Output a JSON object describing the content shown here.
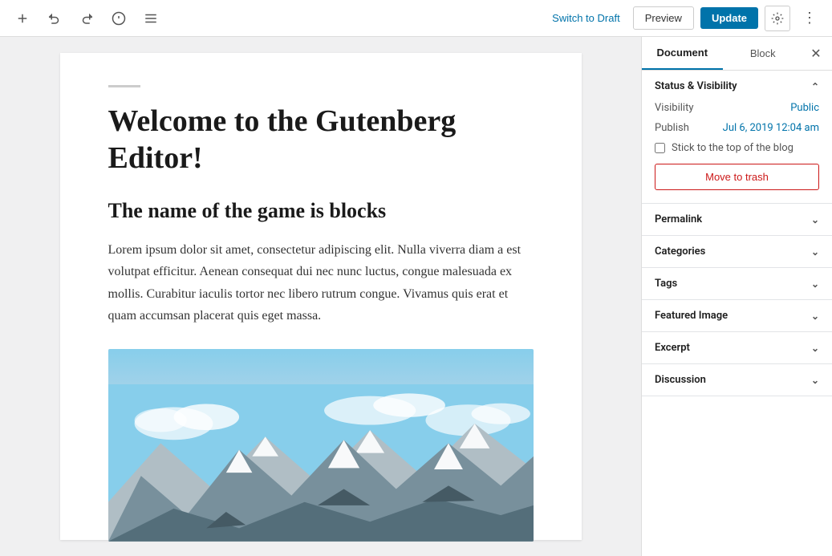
{
  "toolbar": {
    "switch_to_draft_label": "Switch to Draft",
    "preview_label": "Preview",
    "update_label": "Update"
  },
  "editor": {
    "title": "Welcome to the Gutenberg Editor!",
    "heading": "The name of the game is blocks",
    "body": "Lorem ipsum dolor sit amet, consectetur adipiscing elit. Nulla viverra diam a est volutpat efficitur. Aenean consequat dui nec nunc luctus, congue malesuada ex mollis. Curabitur iaculis tortor nec libero rutrum congue. Vivamus quis erat et quam accumsan placerat quis eget massa."
  },
  "sidebar": {
    "document_tab": "Document",
    "block_tab": "Block",
    "sections": {
      "status_visibility": {
        "label": "Status & Visibility",
        "visibility_label": "Visibility",
        "visibility_value": "Public",
        "publish_label": "Publish",
        "publish_value": "Jul 6, 2019 12:04 am",
        "stick_top_label": "Stick to the top of the blog",
        "move_to_trash_label": "Move to trash"
      },
      "permalink": {
        "label": "Permalink"
      },
      "categories": {
        "label": "Categories"
      },
      "tags": {
        "label": "Tags"
      },
      "featured_image": {
        "label": "Featured Image"
      },
      "excerpt": {
        "label": "Excerpt"
      },
      "discussion": {
        "label": "Discussion"
      }
    }
  }
}
